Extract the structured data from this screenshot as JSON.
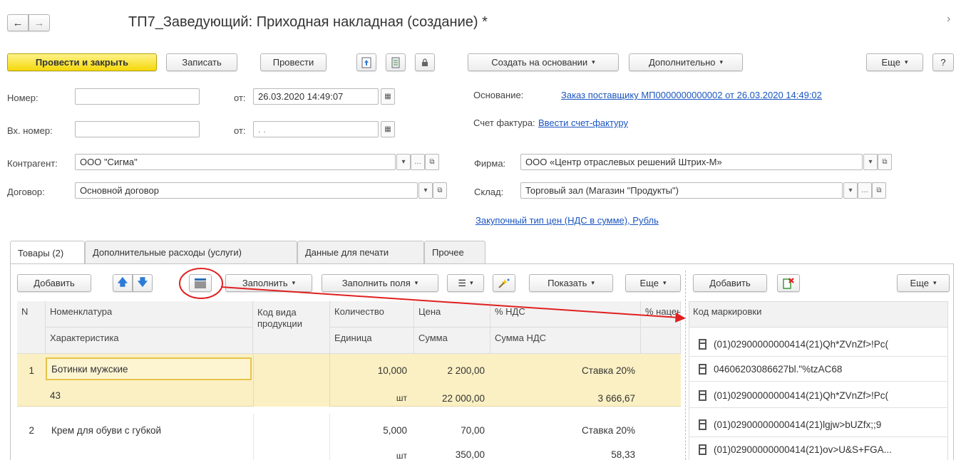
{
  "window": {
    "title": "ТП7_Заведующий: Приходная накладная (создание) *",
    "back": "←",
    "forward": "→",
    "more": "›"
  },
  "toolbar": {
    "post_close": "Провести и закрыть",
    "save": "Записать",
    "post": "Провести",
    "create_based": "Создать на основании",
    "additional": "Дополнительно",
    "more": "Еще",
    "help": "?"
  },
  "form": {
    "number_label": "Номер:",
    "number_value": "",
    "from_label": "от:",
    "date_value": "26.03.2020 14:49:07",
    "in_number_label": "Вх. номер:",
    "in_number_value": "",
    "in_from_label": "от:",
    "in_date_value": " .  .",
    "counterparty_label": "Контрагент:",
    "counterparty_value": "ООО \"Сигма\"",
    "contract_label": "Договор:",
    "contract_value": "Основной договор",
    "basis_label": "Основание:",
    "basis_link": "Заказ поставщику МП0000000000002 от 26.03.2020 14:49:02",
    "invoice_label": "Счет фактура:",
    "invoice_link": "Ввести счет-фактуру",
    "firm_label": "Фирма:",
    "firm_value": "ООО «Центр отраслевых решений Штрих-М»",
    "warehouse_label": "Склад:",
    "warehouse_value": "Торговый зал (Магазин \"Продукты\")",
    "price_type_link": "Закупочный тип цен (НДС в сумме), Рубль"
  },
  "tabs": [
    "Товары (2)",
    "Дополнительные расходы (услуги)",
    "Данные для печати",
    "Прочее"
  ],
  "goods_toolbar": {
    "add": "Добавить",
    "fill": "Заполнить",
    "fill_fields": "Заполнить поля",
    "show": "Показать",
    "more": "Еще"
  },
  "marks_toolbar": {
    "add": "Добавить",
    "more": "Еще"
  },
  "table": {
    "headers": {
      "n": "N",
      "nomenclature": "Номенклатура",
      "characteristic": "Характеристика",
      "kind_code": "Код вида продукции",
      "quantity": "Количество",
      "unit": "Единица",
      "price": "Цена",
      "sum": "Сумма",
      "vat_pct": "% НДС",
      "vat_sum": "Сумма НДС",
      "markup": "% наценки"
    },
    "rows": [
      {
        "n": "1",
        "nomenclature": "Ботинки мужские",
        "characteristic": "43",
        "quantity": "10,000",
        "unit": "шт",
        "price": "2 200,00",
        "sum": "22 000,00",
        "vat_rate": "Ставка 20%",
        "vat_sum": "3 666,67"
      },
      {
        "n": "2",
        "nomenclature": "Крем для обуви с губкой",
        "characteristic": "",
        "quantity": "5,000",
        "unit": "шт",
        "price": "70,00",
        "sum": "350,00",
        "vat_rate": "Ставка 20%",
        "vat_sum": "58,33"
      }
    ]
  },
  "marks": {
    "header": "Код маркировки",
    "codes": [
      "(01)02900000000414(21)Qh*ZVnZf>!Pc(",
      "04606203086627bl.\"%tzAC68",
      "(01)02900000000414(21)Qh*ZVnZf>!Pc(",
      "(01)02900000000414(21)lgjw>bUZfx;;9",
      "(01)02900000000414(21)ov>U&S+FGA..."
    ]
  },
  "colors": {
    "primary": "#f5d80a",
    "link": "#1a55c0",
    "selected_row": "#fbf0c3",
    "annotation": "#e02020"
  }
}
